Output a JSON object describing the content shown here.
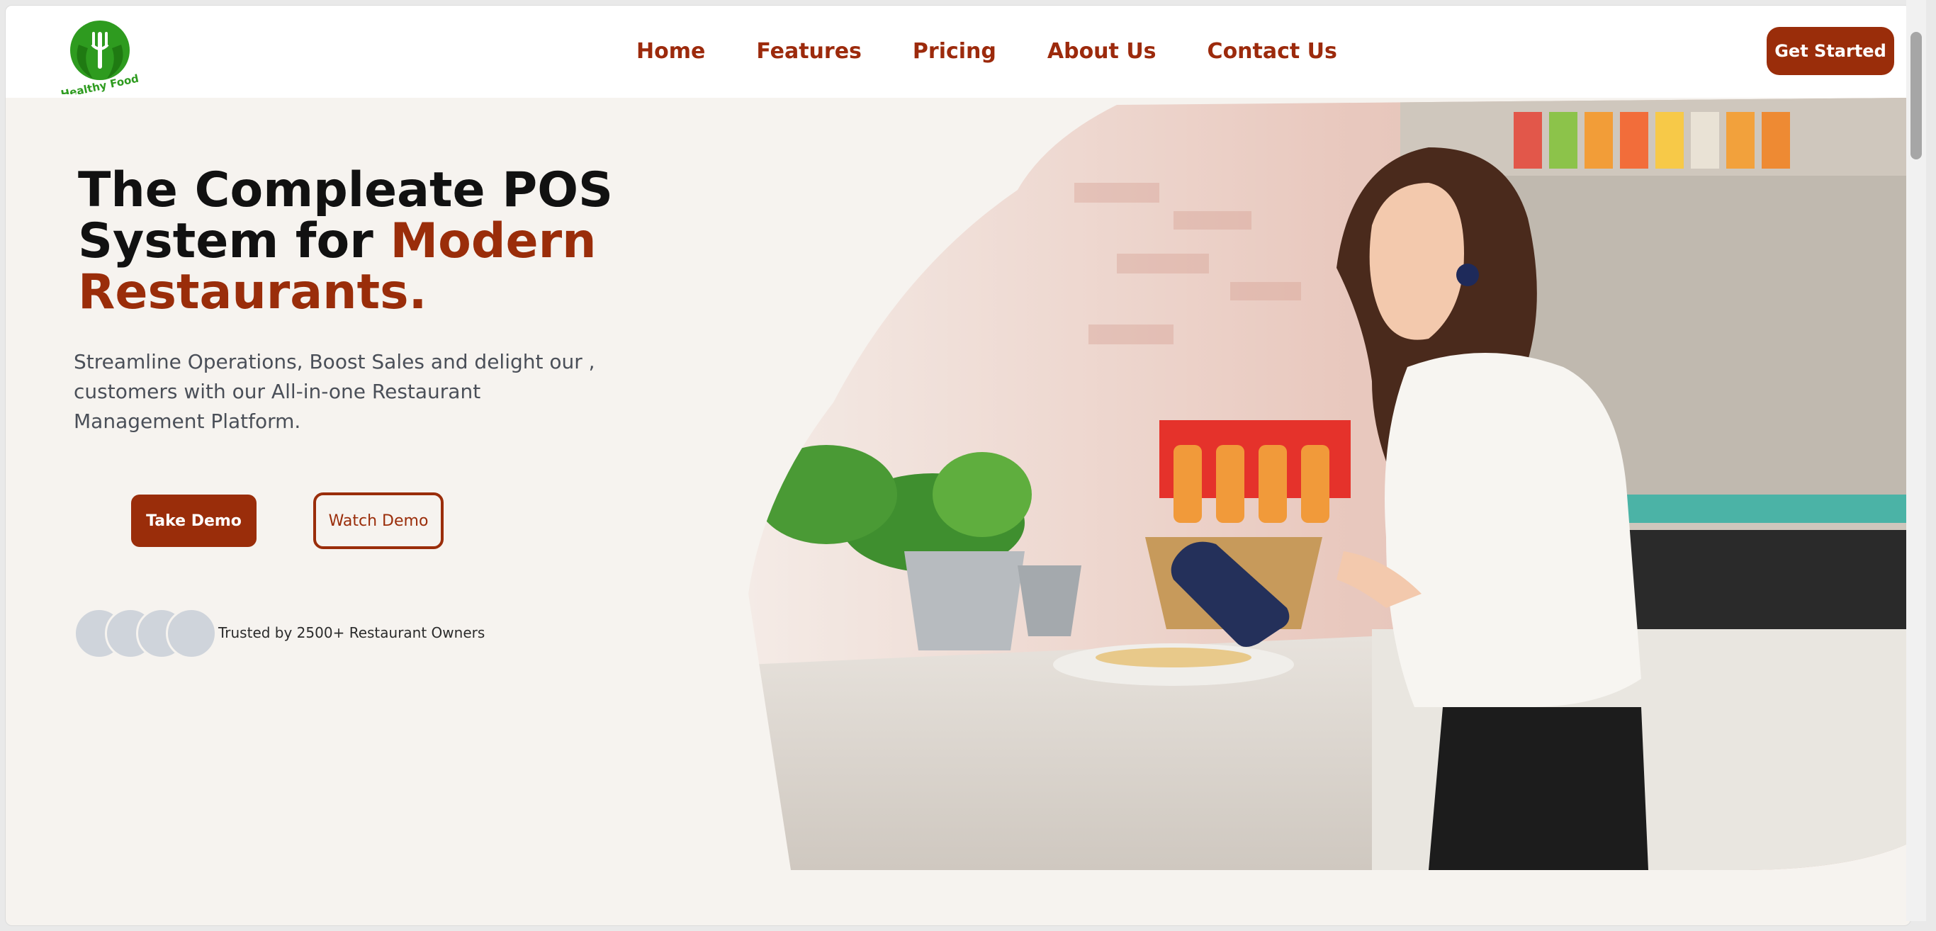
{
  "brand": {
    "logo_alt": "Healthy Food",
    "logo_text": "Healthy Food",
    "logo_icon": "fork-leaf-icon",
    "color_primary": "#9a2d0a",
    "color_logo_green": "#2e9b1f"
  },
  "nav": {
    "items": [
      {
        "label": "Home"
      },
      {
        "label": "Features"
      },
      {
        "label": "Pricing"
      },
      {
        "label": "About Us"
      },
      {
        "label": "Contact Us"
      }
    ],
    "cta_label": "Get Started"
  },
  "hero": {
    "headline_part1": "The Compleate POS System for ",
    "headline_accent": "Modern Restaurants.",
    "subtext": "Streamline Operations, Boost Sales and delight our , customers with our All-in-one Restaurant Management Platform.",
    "primary_button": "Take Demo",
    "secondary_button": "Watch Demo",
    "trusted_text": "Trusted by 2500+ Restaurant Owners",
    "image_alt": "Woman using tablet in restaurant",
    "colors": {
      "background": "#f6f3ef",
      "accent": "#9a2d0a",
      "avatar_placeholder": "#cfd4db"
    }
  }
}
